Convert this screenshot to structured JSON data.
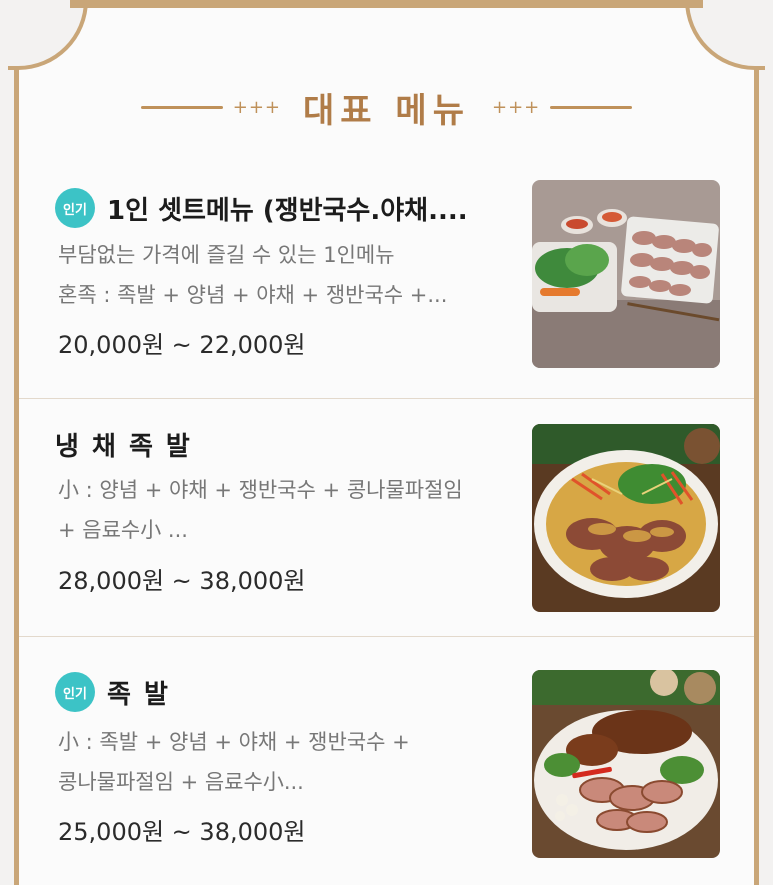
{
  "section": {
    "title": "대표 메뉴",
    "left_deco": "+++",
    "right_deco": "+++"
  },
  "badge_label": "인기",
  "items": [
    {
      "title": "1인 셋트메뉴 (쟁반국수.야채....",
      "popular": true,
      "desc_line1": "부담없는 가격에 즐길 수 있는 1인메뉴",
      "desc_line2": "혼족 : 족발 + 양념 + 야채 + 쟁반국수 +...",
      "price": "20,000원 ~ 22,000원",
      "image": "sliced-jokbal-set-photo"
    },
    {
      "title": "냉 채 족 발",
      "popular": false,
      "desc_line1": "小 : 양념 + 야채 + 쟁반국수 + 콩나물파절임",
      "desc_line2": "+ 음료수小 ...",
      "price": "28,000원 ~ 38,000원",
      "image": "cold-jokbal-salad-photo"
    },
    {
      "title": "족 발",
      "popular": true,
      "desc_line1": "小 : 족발 + 양념 + 야채 + 쟁반국수 +",
      "desc_line2": "콩나물파절임 + 음료수小...",
      "price": "25,000원 ~ 38,000원",
      "image": "jokbal-platter-photo"
    }
  ]
}
